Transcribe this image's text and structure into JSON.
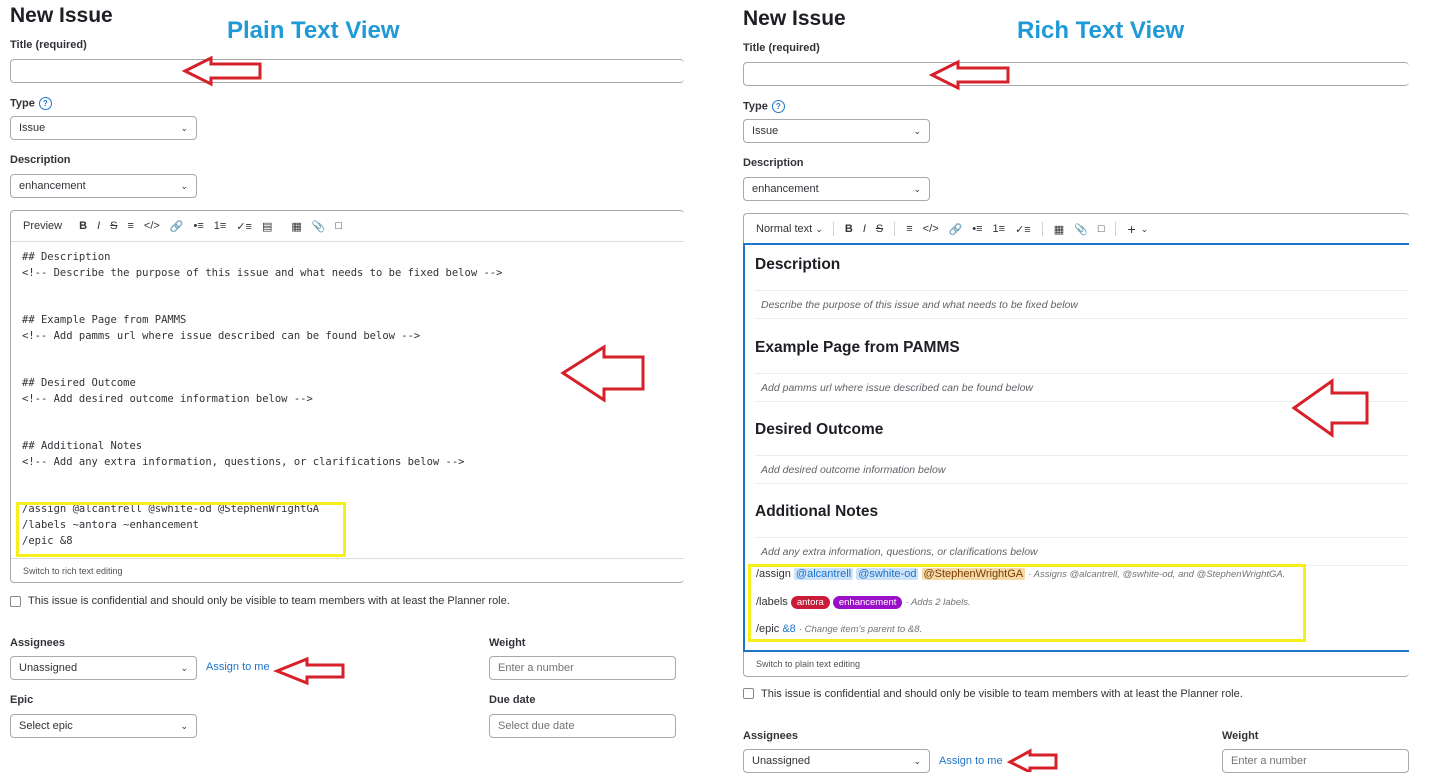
{
  "annotations": {
    "left": "Plain Text View",
    "right": "Rich Text View"
  },
  "form": {
    "heading": "New Issue",
    "title_label": "Title (required)",
    "type_label": "Type",
    "type_help": "?",
    "type_value": "Issue",
    "description_label": "Description",
    "template_value": "enhancement",
    "confidential_text": "This issue is confidential and should only be visible to team members with at least the Planner role.",
    "assignees_label": "Assignees",
    "assignees_value": "Unassigned",
    "assign_to_me": "Assign to me",
    "weight_label": "Weight",
    "weight_placeholder": "Enter a number",
    "epic_label": "Epic",
    "epic_value": "Select epic",
    "due_label": "Due date",
    "due_placeholder": "Select due date"
  },
  "plain": {
    "preview_tab": "Preview",
    "lines": [
      "## Description",
      "<!-- Describe the purpose of this issue and what needs to be fixed below -->",
      "## Example Page from PAMMS",
      "<!-- Add pamms url where issue described can be found below -->",
      "## Desired Outcome",
      "<!-- Add desired outcome information below -->",
      "## Additional Notes",
      "<!-- Add any extra information, questions, or clarifications below -->",
      "/assign @alcantrell @swhite-od @StephenWrightGA",
      "/labels ~antora ~enhancement",
      "/epic &8"
    ],
    "switch_text": "Switch to rich text editing"
  },
  "rich": {
    "format_select": "Normal text",
    "sections": [
      {
        "heading": "Description",
        "placeholder": "Describe the purpose of this issue and what needs to be fixed below"
      },
      {
        "heading": "Example Page from PAMMS",
        "placeholder": "Add pamms url where issue described can be found below"
      },
      {
        "heading": "Desired Outcome",
        "placeholder": "Add desired outcome information below"
      },
      {
        "heading": "Additional Notes",
        "placeholder": "Add any extra information, questions, or clarifications below"
      }
    ],
    "assign_cmd": "/assign",
    "users": [
      "@alcantrell",
      "@swhite-od",
      "@StephenWrightGA"
    ],
    "assign_hint": "· Assigns @alcantrell, @swhite-od, and @StephenWrightGA.",
    "labels_cmd": "/labels",
    "label_antora": "antora",
    "label_enhancement": "enhancement",
    "labels_hint": "· Adds 2 labels.",
    "epic_cmd": "/epic",
    "epic_ref": "&8",
    "epic_hint": "· Change item's parent to &8.",
    "switch_text": "Switch to plain text editing"
  },
  "colors": {
    "arrow": "#d6202a",
    "highlight": "#f6ef1a",
    "annotation": "#1f9ad6",
    "label_antora": "#c91c38",
    "label_enhancement": "#9a10c8",
    "link": "#1f75cb"
  },
  "icons": [
    "bold-icon",
    "italic-icon",
    "strikethrough-icon",
    "quote-icon",
    "code-icon",
    "link-icon",
    "bullet-list-icon",
    "numbered-list-icon",
    "task-list-icon",
    "comment-icon",
    "table-icon",
    "attach-icon",
    "quick-actions-icon",
    "plus-icon",
    "chevron-down-icon",
    "question-icon",
    "arrow-left-icon"
  ]
}
